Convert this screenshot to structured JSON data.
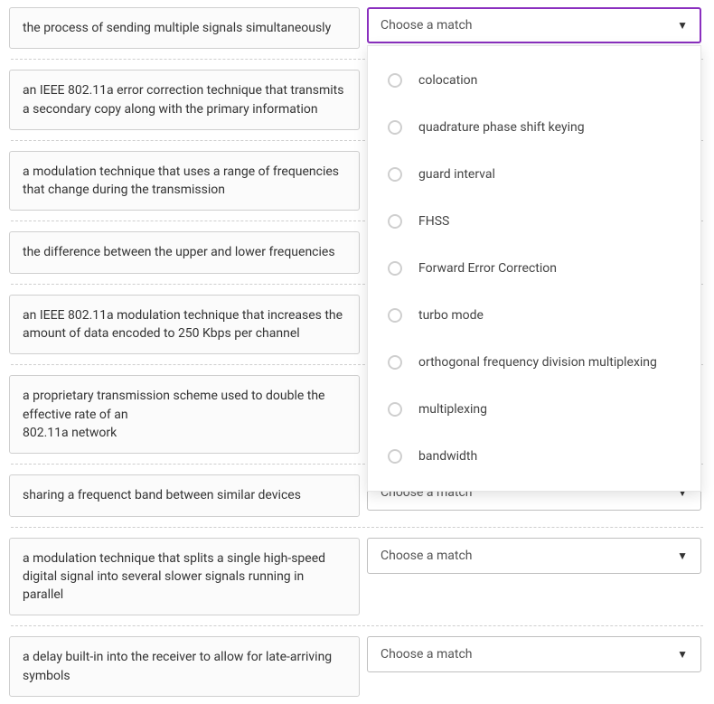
{
  "placeholder": "Choose a match",
  "definitions": [
    "the process of sending multiple signals simultaneously",
    "an IEEE 802.11a error correction technique that transmits a secondary copy along with the primary information",
    "a modulation technique that uses a range of frequencies that change during the transmission",
    "the difference between the upper and lower frequencies",
    "an IEEE 802.11a modulation technique that increases the amount of data encoded to 250 Kbps per channel",
    "a proprietary transmission scheme used to double the effective rate of an\n802.11a network",
    "sharing a frequenct band between similar devices",
    "a modulation technique that splits a single high-speed digital signal into several slower signals running in parallel",
    "a delay built-in into the receiver to allow for late-arriving symbols"
  ],
  "options": [
    "colocation",
    "quadrature phase shift keying",
    "guard interval",
    "FHSS",
    "Forward Error Correction",
    "turbo mode",
    "orthogonal frequency division multiplexing",
    "multiplexing",
    "bandwidth"
  ],
  "focusedIndex": 0,
  "dropdownOpen": true,
  "secondVisibleSelectIndex": 8
}
